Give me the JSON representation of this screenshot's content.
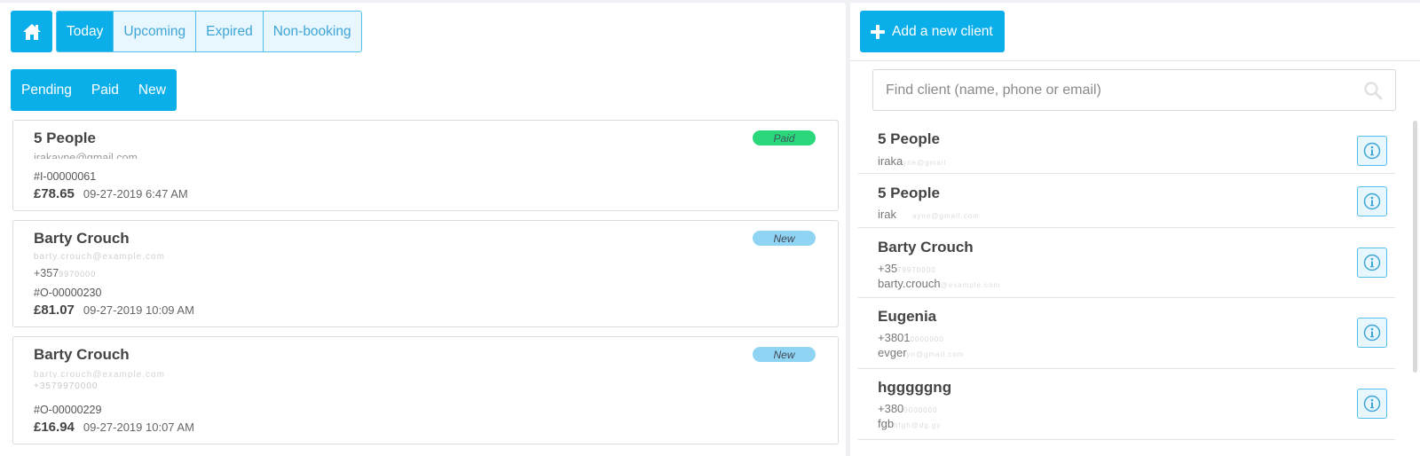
{
  "nav": {
    "home_icon": "home-icon",
    "tabs": [
      {
        "label": "Today",
        "active": true
      },
      {
        "label": "Upcoming",
        "active": false
      },
      {
        "label": "Expired",
        "active": false
      },
      {
        "label": "Non-booking",
        "active": false
      }
    ],
    "filters": [
      "Pending",
      "Paid",
      "New"
    ]
  },
  "orders": [
    {
      "name": "5 People",
      "contact_lines": [
        {
          "visible": "irakayne@gmail.com",
          "hidden": ""
        }
      ],
      "id": "#I-00000061",
      "amount": "£78.65",
      "date": "09-27-2019 6:47 AM",
      "status": "Paid"
    },
    {
      "name": "Barty Crouch",
      "contact_lines": [
        {
          "visible": "",
          "hidden": "barty.crouch@example.com"
        },
        {
          "visible": "+357",
          "hidden": "9970000"
        }
      ],
      "id": "#O-00000230",
      "amount": "£81.07",
      "date": "09-27-2019 10:09 AM",
      "status": "New"
    },
    {
      "name": "Barty Crouch",
      "contact_lines": [
        {
          "visible": "",
          "hidden": "barty.crouch@example.com"
        },
        {
          "visible": "",
          "hidden": "+3579970000"
        }
      ],
      "id": "#O-00000229",
      "amount": "£16.94",
      "date": "09-27-2019 10:07 AM",
      "status": "New"
    }
  ],
  "clients_panel": {
    "add_button_label": "Add a new client",
    "search_placeholder": "Find client (name, phone or email)",
    "search_value": "",
    "clients": [
      {
        "name": "5 People",
        "lines": [
          {
            "visible": "iraka",
            "hidden": "yne@gmail"
          }
        ]
      },
      {
        "name": "5 People",
        "lines": [
          {
            "visible": "irak",
            "hidden": "ayne@gmail.com"
          }
        ]
      },
      {
        "name": "Barty Crouch",
        "lines": [
          {
            "visible": "+35",
            "hidden": "79970000"
          },
          {
            "visible": "barty.crouch",
            "hidden": "@example.com"
          }
        ]
      },
      {
        "name": "Eugenia",
        "lines": [
          {
            "visible": "+3801",
            "hidden": "0000000"
          },
          {
            "visible": "evger",
            "hidden": "yn@gmail.com"
          }
        ]
      },
      {
        "name": "hgggggng",
        "lines": [
          {
            "visible": "+380",
            "hidden": "0000000"
          },
          {
            "visible": "fgb",
            "hidden": "hfgh@dg.gy"
          }
        ]
      }
    ]
  },
  "colors": {
    "accent": "#0aaee8",
    "paid_badge": "#2ad77b",
    "new_badge": "#8fd5f3"
  }
}
